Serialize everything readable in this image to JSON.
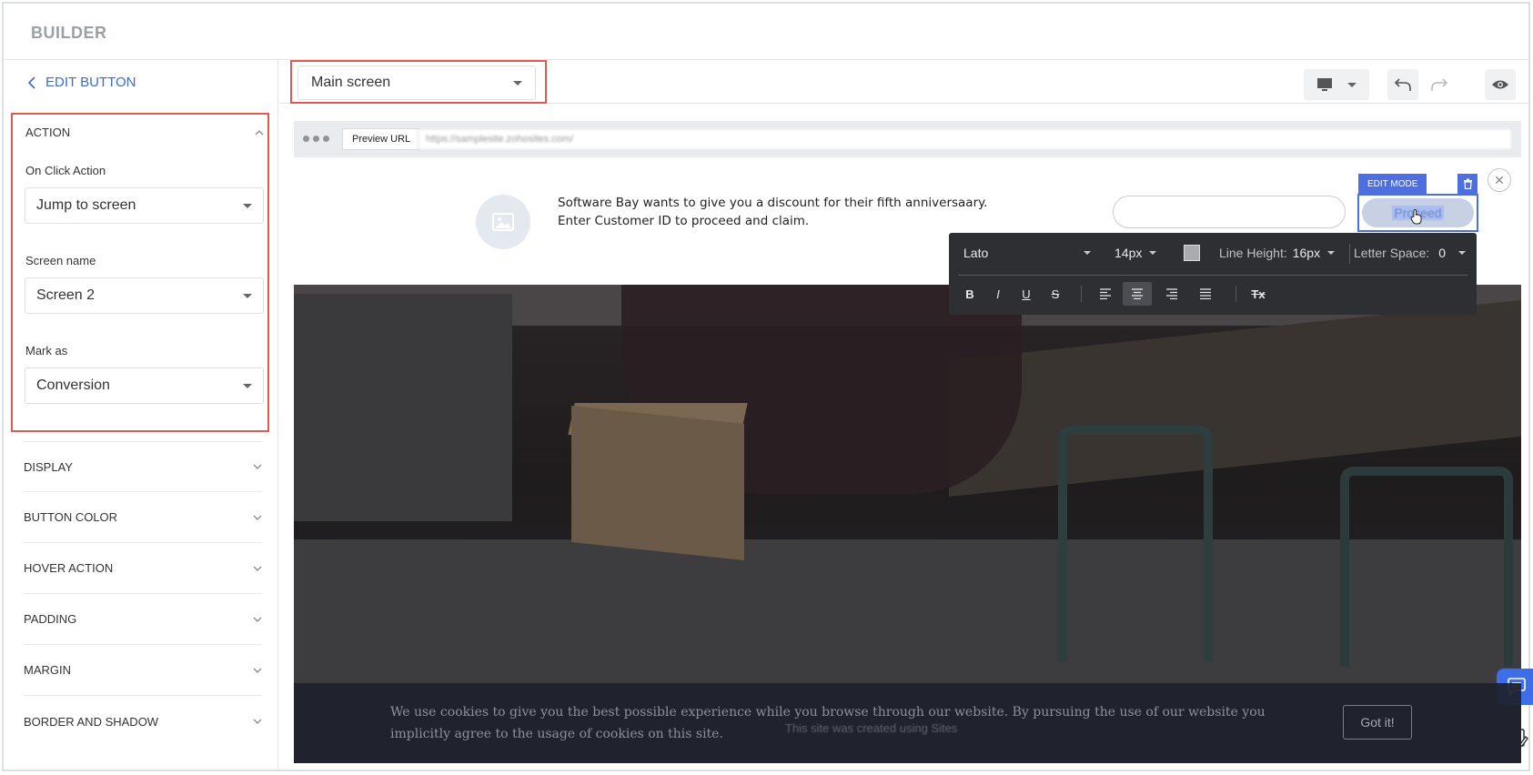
{
  "app": {
    "brand": "BUILDER"
  },
  "sidebar": {
    "back_label": "EDIT BUTTON",
    "action": {
      "title": "ACTION",
      "on_click_label": "On Click Action",
      "on_click_value": "Jump to screen",
      "screen_name_label": "Screen name",
      "screen_name_value": "Screen 2",
      "mark_as_label": "Mark as",
      "mark_as_value": "Conversion"
    },
    "sections": [
      "DISPLAY",
      "BUTTON COLOR",
      "HOVER ACTION",
      "PADDING",
      "MARGIN",
      "BORDER AND SHADOW"
    ]
  },
  "toolbar": {
    "screen_select_value": "Main screen",
    "device_icon": "desktop-icon",
    "undo_icon": "undo-icon",
    "redo_icon": "redo-icon",
    "preview_icon": "eye-icon"
  },
  "preview": {
    "url_tag": "Preview URL",
    "url_value": "https://samplesite.zohosites.com/",
    "promo_text": "Software Bay wants to give you a discount for their fifth anniversaary. Enter Customer ID to proceed and claim.",
    "edit_mode_badge": "EDIT MODE",
    "proceed_label": "Proceed",
    "close_glyph": "✕",
    "footer_ghost": "This site was created using  Sites"
  },
  "text_editor": {
    "font_family": "Lato",
    "font_size": "14px",
    "line_height_label": "Line Height:",
    "line_height_value": "16px",
    "letter_space_label": "Letter Space:",
    "letter_space_value": "0",
    "format_buttons": [
      "B",
      "I",
      "U",
      "S"
    ],
    "clear_format": "Tx",
    "active_align": "center"
  },
  "cookie_banner": {
    "text": "We use cookies to give you the best possible experience while you browse through our website. By pursuing the use of our website you implicitly agree to the usage of cookies on this site.",
    "button_label": "Got it!"
  },
  "colors": {
    "accent_blue": "#4e6fe0",
    "link_blue": "#3b6bd1",
    "highlight_red": "#e05a4f",
    "editor_bg": "#2e2f33"
  }
}
